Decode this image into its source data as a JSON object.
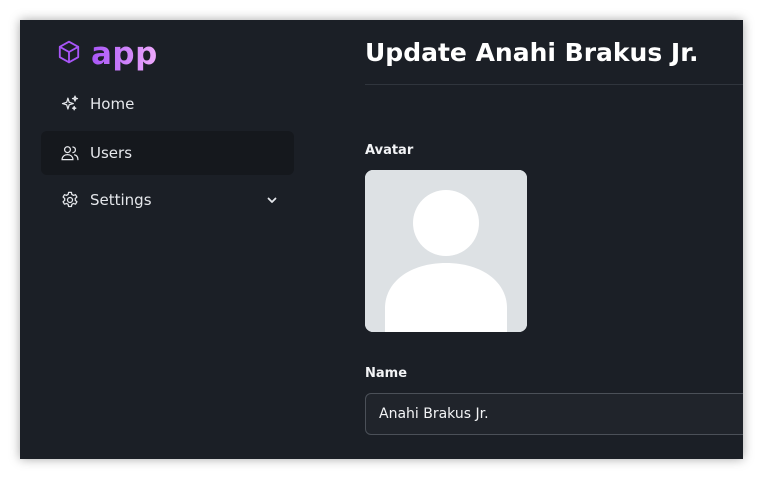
{
  "app": {
    "name": "app"
  },
  "sidebar": {
    "items": [
      {
        "label": "Home",
        "icon": "sparkles-icon"
      },
      {
        "label": "Users",
        "icon": "users-icon",
        "active": true
      },
      {
        "label": "Settings",
        "icon": "gear-icon",
        "expandable": true
      }
    ]
  },
  "main": {
    "title": "Update Anahi Brakus Jr.",
    "avatar_label": "Avatar",
    "name_label": "Name",
    "name_value": "Anahi Brakus Jr."
  },
  "colors": {
    "background": "#1b1f26",
    "brand_from": "#a855f7",
    "brand_to": "#f0abfc",
    "active_item": "#15181d"
  }
}
